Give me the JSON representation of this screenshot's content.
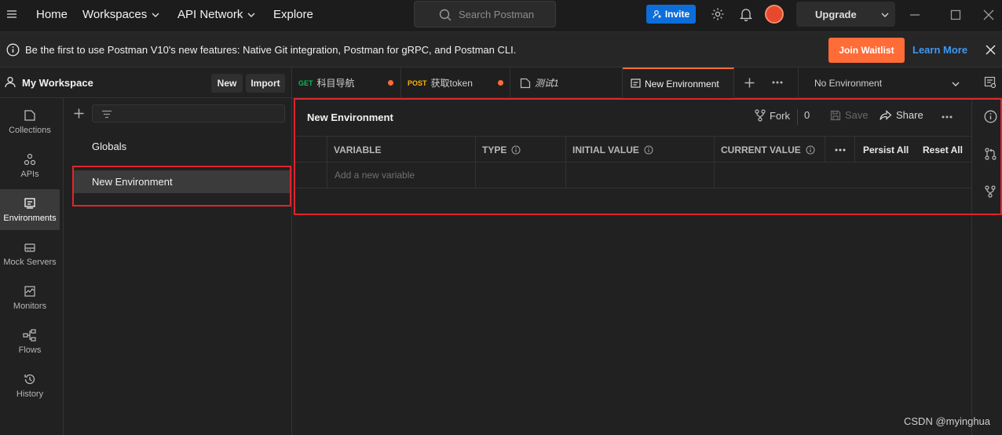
{
  "topbar": {
    "nav": [
      "Home",
      "Workspaces",
      "API Network",
      "Explore"
    ],
    "search_placeholder": "Search Postman",
    "invite_label": "Invite",
    "upgrade_label": "Upgrade"
  },
  "banner": {
    "text": "Be the first to use Postman V10's new features: Native Git integration, Postman for gRPC, and Postman CLI.",
    "join_label": "Join Waitlist",
    "learn_more_label": "Learn More"
  },
  "workspace": {
    "title": "My Workspace",
    "new_label": "New",
    "import_label": "Import"
  },
  "rail": [
    {
      "label": "Collections",
      "icon": "collections-icon"
    },
    {
      "label": "APIs",
      "icon": "apis-icon"
    },
    {
      "label": "Environments",
      "icon": "environments-icon",
      "active": true
    },
    {
      "label": "Mock Servers",
      "icon": "mock-servers-icon"
    },
    {
      "label": "Monitors",
      "icon": "monitors-icon"
    },
    {
      "label": "Flows",
      "icon": "flows-icon"
    },
    {
      "label": "History",
      "icon": "history-icon"
    }
  ],
  "environments": [
    "Globals",
    "New Environment"
  ],
  "tabs": [
    {
      "method": "GET",
      "label": "科目导航",
      "method_color": "#0cbb52"
    },
    {
      "method": "POST",
      "label": "获取token",
      "method_color": "#ffb400"
    },
    {
      "label": "测试1"
    },
    {
      "label": "New Environment",
      "active": true
    }
  ],
  "env_selector": "No Environment",
  "editor": {
    "title": "New Environment",
    "fork_label": "Fork",
    "fork_count": "0",
    "save_label": "Save",
    "share_label": "Share",
    "columns": {
      "variable": "VARIABLE",
      "type": "TYPE",
      "initial": "INITIAL VALUE",
      "current": "CURRENT VALUE",
      "persist_all": "Persist All",
      "reset_all": "Reset All"
    },
    "new_variable_placeholder": "Add a new variable"
  },
  "watermark": "CSDN @myinghua",
  "colors": {
    "accent": "#ff6c37",
    "invite": "#0d6ed9",
    "link": "#3d98f2",
    "highlight": "#e0252b"
  }
}
